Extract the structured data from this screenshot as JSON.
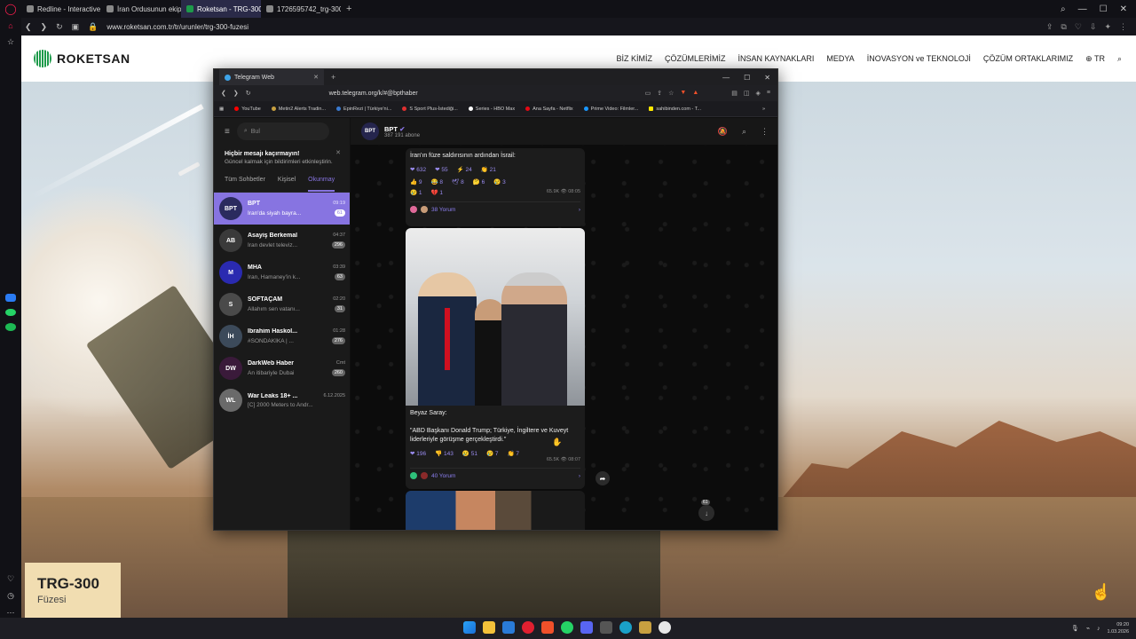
{
  "outer_browser": {
    "tabs": [
      {
        "label": "Redline - Interactive Strat...",
        "active": false
      },
      {
        "label": "İran Ordusunun ekipman...",
        "active": false
      },
      {
        "label": "Roketsan - TRG-300 Füze...",
        "active": true
      },
      {
        "label": "1726595742_trg-300.pdf",
        "active": false
      }
    ],
    "url": "www.roketsan.com.tr/tr/urunler/trg-300-fuzesi"
  },
  "site": {
    "logo": "ROKETSAN",
    "nav": [
      "BİZ KİMİZ",
      "ÇÖZÜMLERİMİZ",
      "İNSAN KAYNAKLARI",
      "MEDYA",
      "İNOVASYON ve TEKNOLOJİ",
      "ÇÖZÜM ORTAKLARIMIZ",
      "TR"
    ],
    "product_title": "TRG-300",
    "product_subtitle": "Füzesi"
  },
  "inner_browser": {
    "tab_title": "Telegram Web",
    "url": "web.telegram.org/k/#@bpthaber",
    "bookmarks": [
      "YouTube",
      "Metin2 Alerts Tradin...",
      "EpinRezi | Türkiye'ni...",
      "S Sport Plus-İstediği...",
      "Series - HBO Max",
      "Ana Sayfa - Netflix",
      "Prime Video: Filmler...",
      "sahibinden.com - T..."
    ]
  },
  "telegram": {
    "search_placeholder": "Bul",
    "notice": {
      "title": "Hiçbir mesajı kaçırmayın!",
      "text": "Güncel kalmak için bildirimleri etkinleştirin."
    },
    "tabs": [
      "Tüm Sohbetler",
      "Kişisel",
      "Okunmay"
    ],
    "chats": [
      {
        "name": "BPT",
        "time": "09:19",
        "preview": "İran'da siyah bayra...",
        "unread": "61",
        "avatar_text": "BPT",
        "avatar_color": "#2b2b5e"
      },
      {
        "name": "Asayiş Berkemal",
        "time": "04:37",
        "preview": "İran devlet televiz...",
        "unread": "296",
        "avatar_text": "AB",
        "avatar_color": "#3a3a3a"
      },
      {
        "name": "MHA",
        "time": "03:39",
        "preview": "İran, Hamaney'in k...",
        "unread": "63",
        "avatar_text": "M",
        "avatar_color": "#2a2ab0"
      },
      {
        "name": "SOFTAÇAM",
        "time": "02:20",
        "preview": "Allahım sen vatanı...",
        "unread": "31",
        "avatar_text": "S",
        "avatar_color": "#4a4a4a"
      },
      {
        "name": "İbrahim Haskol...",
        "time": "01:28",
        "preview": "#SONDAKİKA | ...",
        "unread": "276",
        "avatar_text": "İH",
        "avatar_color": "#3c4a5a"
      },
      {
        "name": "DarkWeb Haber",
        "time": "Cmt",
        "preview": "An itibariyle Dubai",
        "unread": "260",
        "avatar_text": "DW",
        "avatar_color": "#3a1a3a"
      },
      {
        "name": "War Leaks 18+ ...",
        "time": "6.12.2025",
        "preview": "[C] 2000 Meters to Andr...",
        "unread": "",
        "avatar_text": "WL",
        "avatar_color": "#6a6a6a"
      }
    ],
    "channel": {
      "name": "BPT",
      "subscribers": "387 191 abone"
    },
    "posts": {
      "first": {
        "text": "İran'ın füze saldırısının ardından İsrail:",
        "reactions_row1": [
          "❤ 632",
          "❤ 55",
          "⚡ 24",
          "👏 21"
        ],
        "reactions_row2": [
          "👍 9",
          "😂 8",
          "🕊 8",
          "🤔 6",
          "😢 3"
        ],
        "reactions_row3": [
          "😢 1",
          "💔 1"
        ],
        "views": "65.9K",
        "time": "08:05",
        "comments": "38 Yorum"
      },
      "second": {
        "caption_head": "Beyaz Saray:",
        "quote": "\"ABD Başkanı Donald Trump; Türkiye, İngiltere ve Kuveyt liderleriyle görüşme gerçekleştirdi.\"",
        "reactions": [
          "❤ 196",
          "👎 143",
          "😢 51",
          "😢 7",
          "👏 7"
        ],
        "views": "65.5K",
        "time": "08:07",
        "comments": "40 Yorum"
      }
    },
    "scroll_unread": "61"
  },
  "taskbar": {
    "time": "09:20",
    "date": "1.03.2026"
  }
}
